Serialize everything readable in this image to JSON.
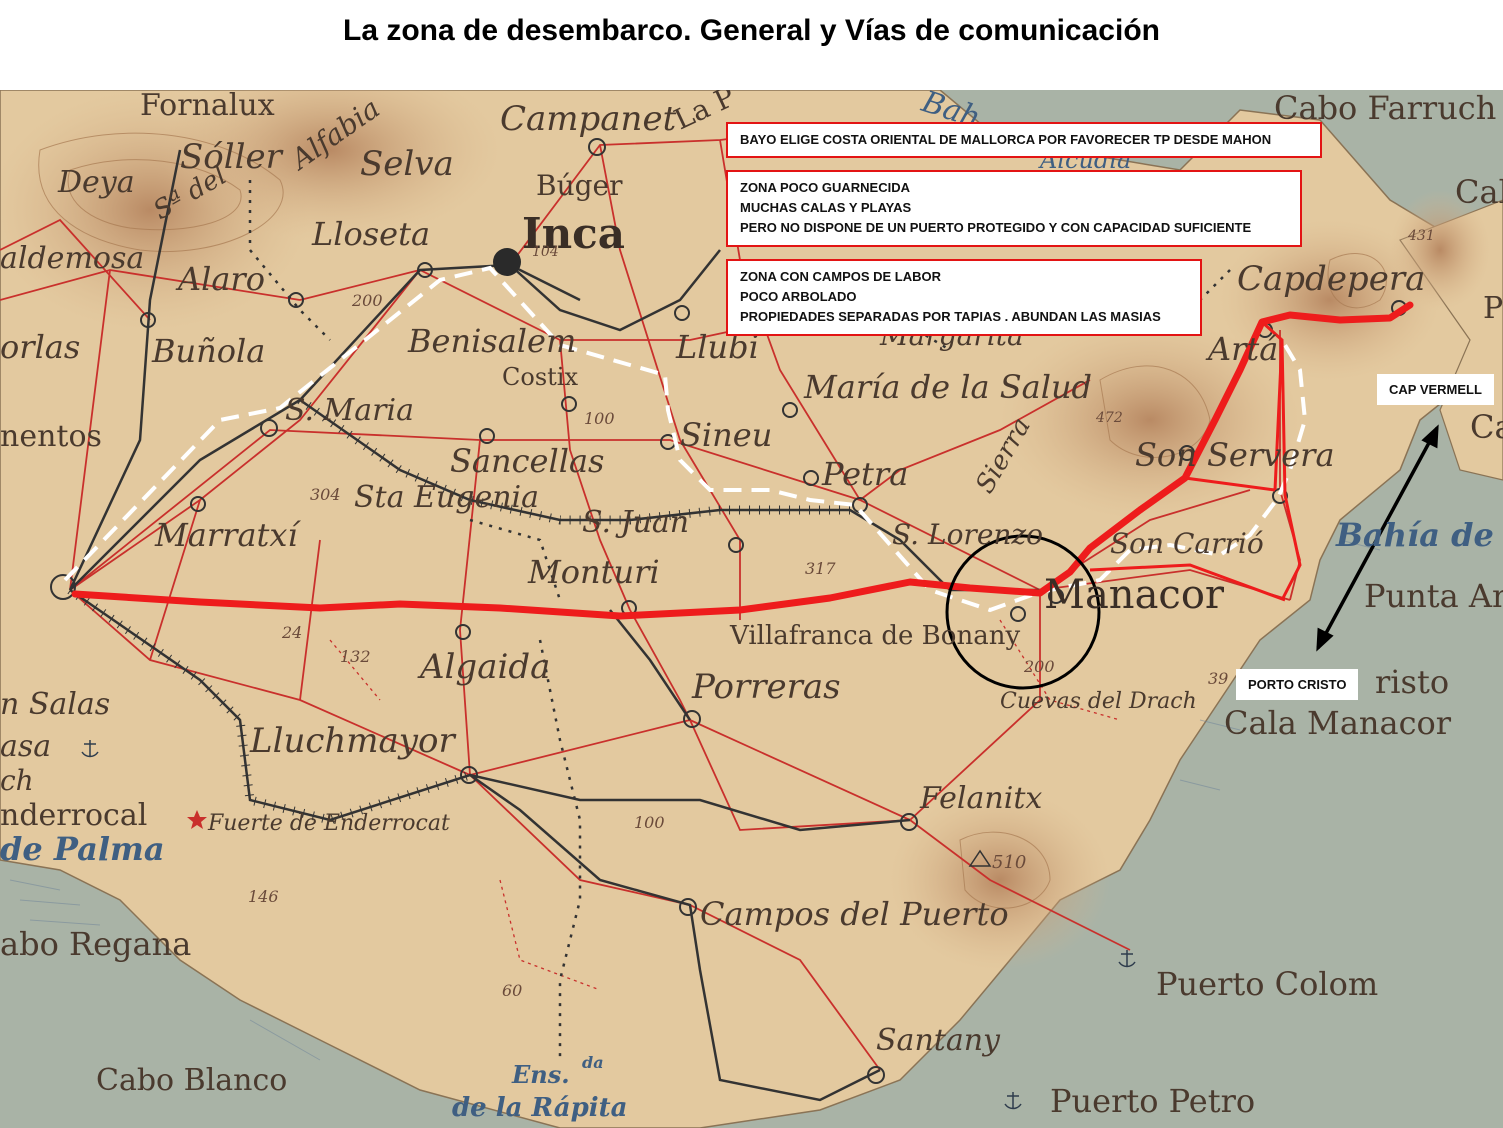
{
  "title": "La zona de desembarco. General y Vías de comunicación",
  "notes": [
    {
      "lines": [
        "BAYO ELIGE COSTA ORIENTAL DE MALLORCA POR FAVORECER TP DESDE MAHON"
      ]
    },
    {
      "lines": [
        "ZONA POCO GUARNECIDA",
        "MUCHAS CALAS Y PLAYAS",
        "PERO NO DISPONE DE UN PUERTO PROTEGIDO Y CON CAPACIDAD SUFICIENTE"
      ]
    },
    {
      "lines": [
        "ZONA CON CAMPOS DE LABOR",
        "POCO ARBOLADO",
        "PROPIEDADES SEPARADAS POR TAPIAS . ABUNDAN LAS MASIAS"
      ]
    }
  ],
  "callouts": {
    "cap_vermell": "CAP VERMELL",
    "porto_cristo": "PORTO CRISTO"
  },
  "places": {
    "fornalux": "Fornalux",
    "soller": "Sóller",
    "alfabia": "Alfabia",
    "campanet": "Campanet",
    "la_puebla": "La P",
    "bah": "Bah",
    "alcudia": "Alcudia",
    "cabo_farruch": "Cabo Farruch",
    "cab_ne": "Cab",
    "deya": "Deya",
    "sra_del": "Sª del",
    "selva": "Selva",
    "buger": "Búger",
    "inca": "Inca",
    "lloseta": "Lloseta",
    "valldemosa": "aldemosa",
    "alaro": "Alaro",
    "capdepera": "Capdepera",
    "p_e": "P",
    "orlas": "orlas",
    "bunola": "Buñola",
    "benisalem": "Benisalem",
    "llubi": "Llubi",
    "margarita": "Margarita",
    "arta": "Artá",
    "costix": "Costix",
    "s_maria": "S. Maria",
    "maria_salud": "María de la Salud",
    "mentos": "nentos",
    "sineu": "Sineu",
    "cab_e": "Cab",
    "sancellas": "Sancellas",
    "sierra": "Sierra",
    "son_servera": "Son Servera",
    "sta_eugenia": "Sta Eugenia",
    "petra": "Petra",
    "s_juan": "S. Juan",
    "marratxi": "Marratxí",
    "s_lorenzo": "S. Lorenzo",
    "son_cardazar": "Son Carrió",
    "bahia_de": "Bahía de",
    "monturi": "Monturi",
    "manacor": "Manacor",
    "punta_an": "Punta An",
    "villafranca": "Villafranca de Bonany",
    "algaida": "Algaida",
    "porreras": "Porreras",
    "risto": "risto",
    "cala_manacor": "Cala Manacor",
    "cuevas_drach": "Cuevas del Drach",
    "n_salas": "n Salas",
    "asa": "asa",
    "ch": "ch",
    "lluchmayor": "Lluchmayor",
    "enderrocal": "nderrocal",
    "fuerte_enderrocat": "Fuerte de Enderrocat",
    "de_palma": "de Palma",
    "felanitx": "Felanitx",
    "campos": "Campos del Puerto",
    "abo_regana": "abo Regana",
    "puerto_colom": "Puerto Colom",
    "santany": "Santany",
    "cabo_blanco": "Cabo Blanco",
    "ens": "Ens.",
    "da": "da",
    "rapita": "de la Rápita",
    "puerto_petro": "Puerto Petro"
  },
  "elevations": {
    "e104": "104",
    "e200": "200",
    "e100a": "100",
    "e304": "304",
    "e317": "317",
    "e24": "24",
    "e132": "132",
    "e472": "472",
    "e200b": "200",
    "e39": "39",
    "e100b": "100",
    "e510": "510",
    "e146": "146",
    "e60": "60",
    "e431": "431"
  },
  "colors": {
    "route": "#ee1c1c",
    "dashed": "#ffffff",
    "rail": "#333333",
    "land": "#e3c99f",
    "sea": "#a9b3a6",
    "road": "#c9302c"
  }
}
